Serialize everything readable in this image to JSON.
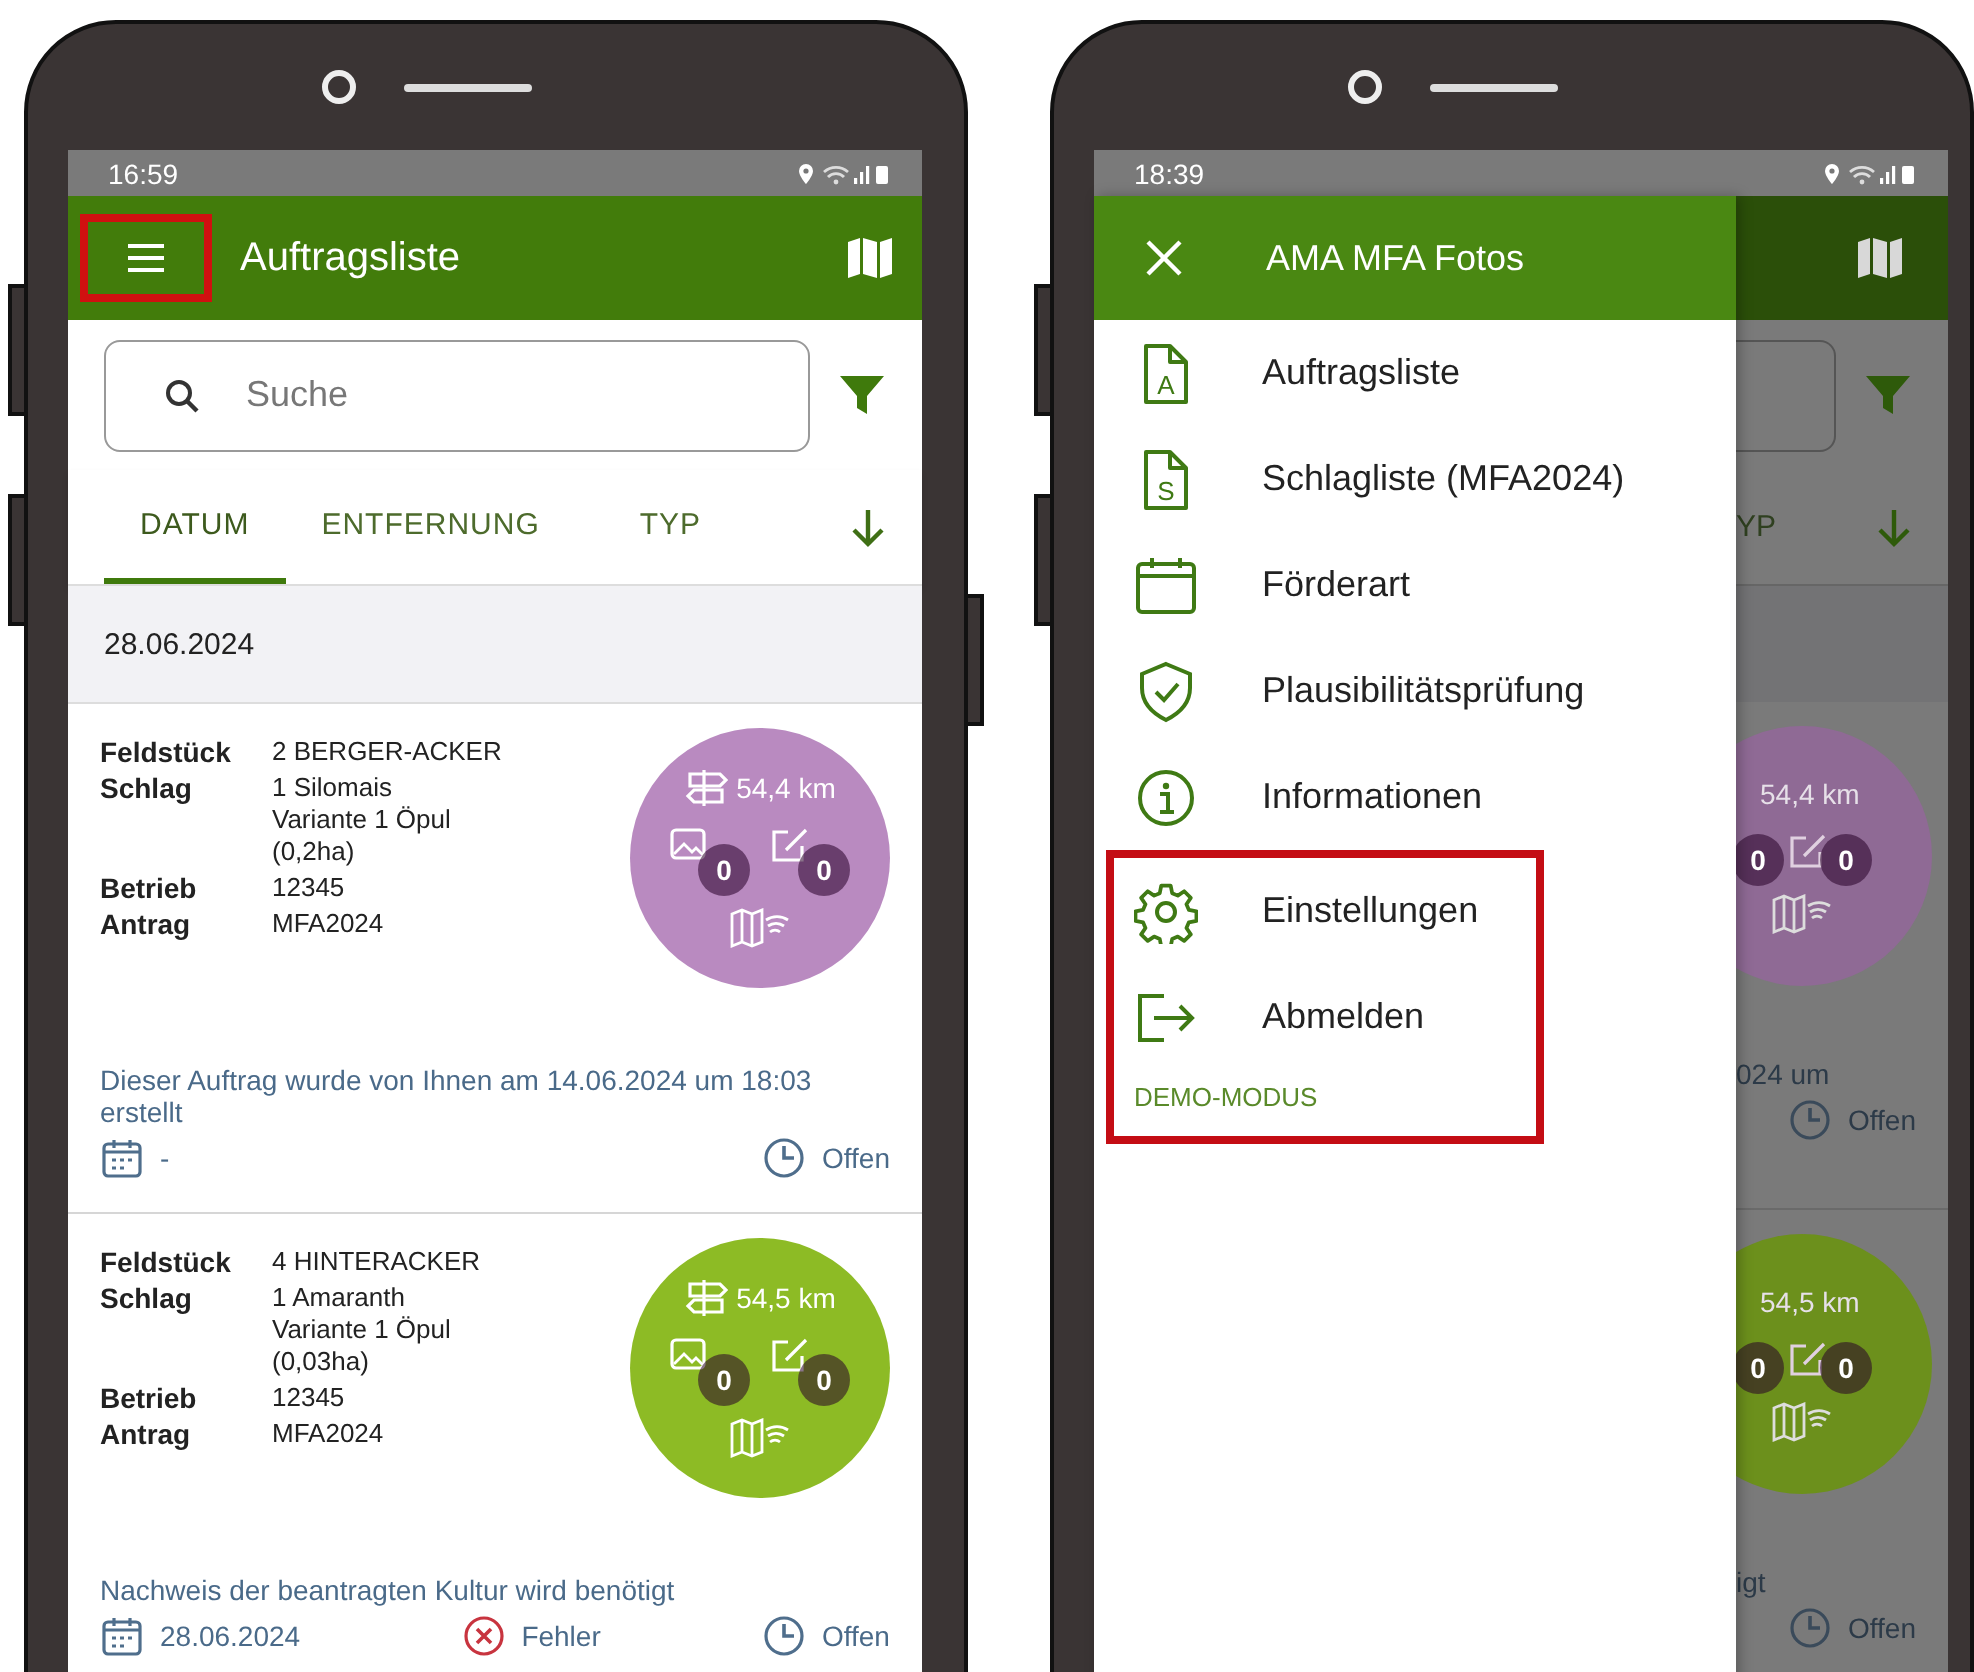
{
  "list_screen": {
    "status_time": "16:59",
    "app_bar": {
      "title": "Auftragsliste",
      "menu_highlighted": true
    },
    "search": {
      "placeholder": "Suche"
    },
    "tabs": [
      {
        "label": "DATUM",
        "selected": true
      },
      {
        "label": "ENTFERNUNG",
        "selected": false
      },
      {
        "label": "TYP",
        "selected": false
      }
    ],
    "date_header": "28.06.2024",
    "cards": [
      {
        "fields": [
          {
            "label": "Feldstück",
            "lines": [
              "2 BERGER-ACKER"
            ]
          },
          {
            "label": "Schlag",
            "lines": [
              "1 Silomais",
              "Variante 1 Öpul",
              "(0,2ha)"
            ]
          },
          {
            "label": "Betrieb",
            "lines": [
              "12345"
            ]
          },
          {
            "label": "Antrag",
            "lines": [
              "MFA2024"
            ]
          }
        ],
        "color": "#b98ac0",
        "distance": "54,4 km",
        "photo_count": "0",
        "note_count": "0",
        "message": "Dieser Auftrag wurde von Ihnen am 14.06.2024 um 18:03 erstellt",
        "date": "-",
        "status": "Offen"
      },
      {
        "fields": [
          {
            "label": "Feldstück",
            "lines": [
              "4 HINTERACKER"
            ]
          },
          {
            "label": "Schlag",
            "lines": [
              "1 Amaranth",
              "Variante 1 Öpul",
              "(0,03ha)"
            ]
          },
          {
            "label": "Betrieb",
            "lines": [
              "12345"
            ]
          },
          {
            "label": "Antrag",
            "lines": [
              "MFA2024"
            ]
          }
        ],
        "color": "#8dbb25",
        "distance": "54,5 km",
        "photo_count": "0",
        "note_count": "0",
        "message": "Nachweis der beantragten Kultur wird benötigt",
        "date": "28.06.2024",
        "error": "Fehler",
        "status": "Offen"
      }
    ]
  },
  "drawer_screen": {
    "status_time": "18:39",
    "drawer": {
      "title": "AMA MFA Fotos",
      "items": [
        {
          "label": "Auftragsliste",
          "kind": "document",
          "icon_letter": "A"
        },
        {
          "label": "Schlagliste (MFA2024)",
          "kind": "document",
          "icon_letter": "S"
        },
        {
          "label": "Förderart",
          "kind": "calendar"
        },
        {
          "label": "Plausibilitätsprüfung",
          "kind": "shield"
        },
        {
          "label": "Informationen",
          "kind": "info"
        }
      ],
      "highlight_box": {
        "items": [
          {
            "label": "Einstellungen",
            "kind": "gear"
          },
          {
            "label": "Abmelden",
            "kind": "logout"
          }
        ],
        "mode_label": "DEMO-MODUS"
      }
    },
    "backdrop": {
      "tab_fragment": "YP",
      "cards": [
        {
          "color": "#8f6a95",
          "distance": "54,4 km",
          "photo_count": "0",
          "note_count": "0",
          "message_fragment": "024 um",
          "status": "Offen"
        },
        {
          "color": "#6c901c",
          "distance": "54,5 km",
          "photo_count": "0",
          "note_count": "0",
          "message_fragment": "igt",
          "status": "Offen"
        }
      ]
    }
  }
}
